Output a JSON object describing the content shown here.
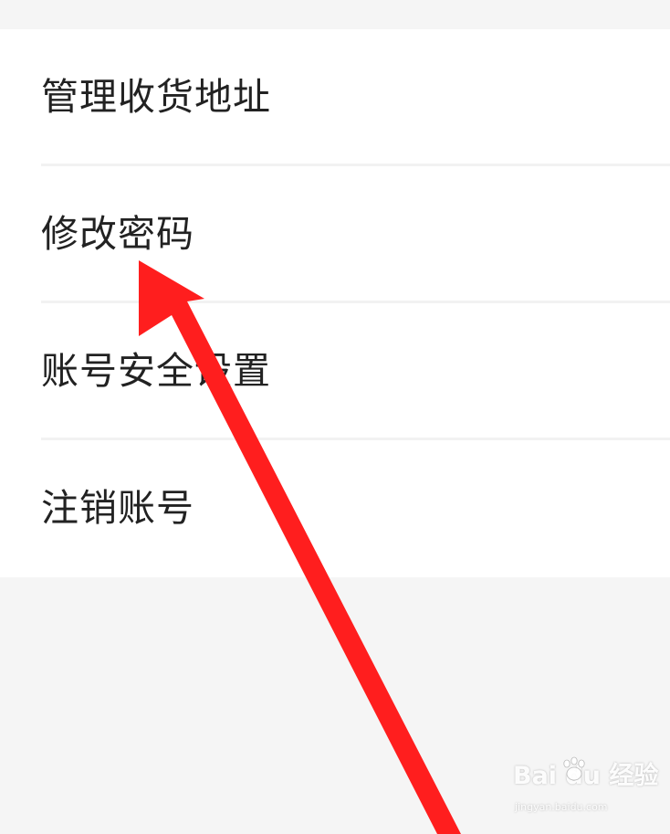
{
  "menu": {
    "items": [
      {
        "label": "管理收货地址"
      },
      {
        "label": "修改密码"
      },
      {
        "label": "账号安全设置"
      },
      {
        "label": "注销账号"
      }
    ]
  },
  "annotation": {
    "arrow_color": "#ff1e1e"
  },
  "watermark": {
    "logo_text": "Bai du 经验",
    "url_text": "jingyan.baidu.com"
  },
  "colors": {
    "background": "#f5f5f5",
    "list_background": "#ffffff",
    "text": "#222222",
    "divider": "#f2f2f2"
  }
}
